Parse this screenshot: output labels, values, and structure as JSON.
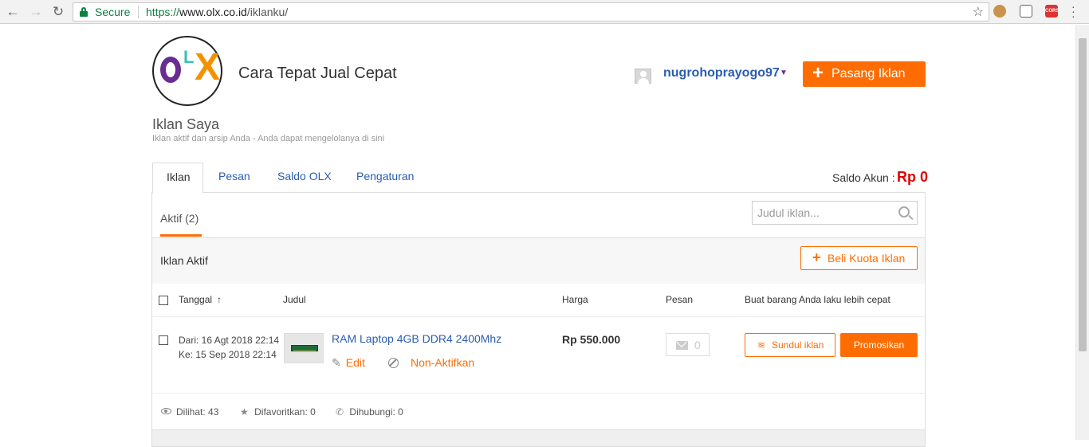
{
  "browser": {
    "secure_label": "Secure",
    "url_scheme": "https://",
    "url_host": "www.olx.co.id",
    "url_path": "/iklanku/",
    "ext_cors": "CORS"
  },
  "header": {
    "tagline": "Cara Tepat Jual Cepat",
    "logo_o": "O",
    "logo_l": "L",
    "logo_x": "X",
    "username": "nugrohoprayogo97",
    "post_button": "Pasang Iklan"
  },
  "page": {
    "title": "Iklan Saya",
    "subtitle": "Iklan aktif dan arsip Anda - Anda dapat mengelolanya di sini"
  },
  "tabs": [
    {
      "label": "Iklan"
    },
    {
      "label": "Pesan"
    },
    {
      "label": "Saldo OLX"
    },
    {
      "label": "Pengaturan"
    }
  ],
  "balance": {
    "label": "Saldo Akun :",
    "value": "Rp 0"
  },
  "panel": {
    "subtab_label": "Aktif",
    "subtab_count": "(2)",
    "search_placeholder": "Judul iklan...",
    "section_title": "Iklan Aktif",
    "buy_quota_button": "Beli Kuota Iklan",
    "columns": {
      "date": "Tanggal",
      "title": "Judul",
      "price": "Harga",
      "messages": "Pesan",
      "promote": "Buat barang Anda laku lebih cepat"
    }
  },
  "listing": {
    "date_from": "Dari: 16 Agt 2018 22:14",
    "date_to": "Ke: 15 Sep 2018 22:14",
    "title": "RAM Laptop 4GB DDR4 2400Mhz",
    "edit_label": "Edit",
    "deactivate_label": "Non-Aktifkan",
    "price": "Rp 550.000",
    "message_count": "0",
    "bump_button": "Sundul iklan",
    "promote_button": "Promosikan",
    "stats": {
      "views": "Dilihat: 43",
      "favorites": "Difavoritkan: 0",
      "contacted": "Dihubungi: 0"
    }
  },
  "colors": {
    "accent_orange": "#ff6d02",
    "link_blue": "#2a5db0",
    "balance_red": "#e30000",
    "olx_purple": "#6a2c91",
    "olx_teal": "#3fbfb4",
    "olx_orange": "#f39200"
  }
}
